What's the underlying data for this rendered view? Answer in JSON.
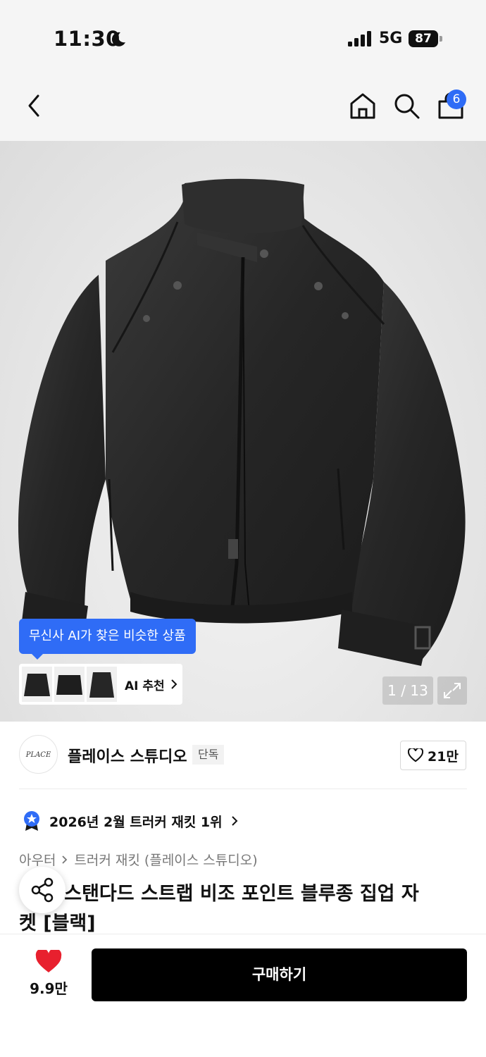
{
  "status_bar": {
    "time": "11:30",
    "network": "5G",
    "battery": "87"
  },
  "header": {
    "cart_count": "6"
  },
  "gallery": {
    "ai_tooltip": "무신사 AI가 찾은 비슷한 상품",
    "ai_recommend_label": "AI 추천",
    "counter": "1 / 13"
  },
  "brand": {
    "name": "플레이스 스튜디오",
    "tag": "단독",
    "likes": "21만"
  },
  "ranking": {
    "text": "2026년 2월 트러커 재킷 1위"
  },
  "breadcrumb": {
    "category": "아우터",
    "subcategory": "트러커 재킷 (플레이스 스튜디오)"
  },
  "product": {
    "title_line1": "릭 스탠다드 스트랩 비조 포인트 블루종 집업 자",
    "title_line2": "켓 [블랙]"
  },
  "footer": {
    "wish_count": "9.9만",
    "buy_label": "구매하기"
  },
  "colors": {
    "accent": "#2f6cf6",
    "heart": "#e8202e",
    "buy_bg": "#000000"
  }
}
